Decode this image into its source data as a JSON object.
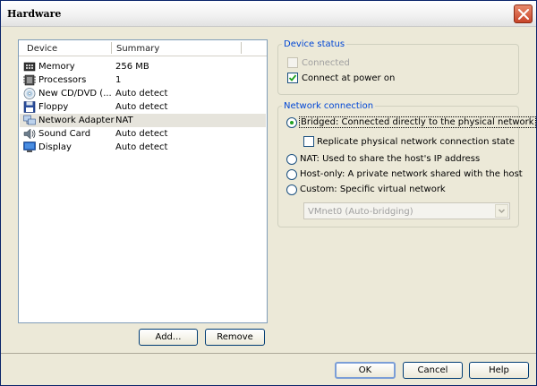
{
  "window": {
    "title": "Hardware"
  },
  "device_list": {
    "columns": [
      "Device",
      "Summary"
    ],
    "rows": [
      {
        "device": "Memory",
        "summary": "256 MB",
        "icon": "memory-icon"
      },
      {
        "device": "Processors",
        "summary": "1",
        "icon": "processor-icon"
      },
      {
        "device": "New CD/DVD (...",
        "summary": "Auto detect",
        "icon": "cd-dvd-icon"
      },
      {
        "device": "Floppy",
        "summary": "Auto detect",
        "icon": "floppy-icon"
      },
      {
        "device": "Network Adapter",
        "summary": "NAT",
        "icon": "network-adapter-icon",
        "selected": true
      },
      {
        "device": "Sound Card",
        "summary": "Auto detect",
        "icon": "sound-card-icon"
      },
      {
        "device": "Display",
        "summary": "Auto detect",
        "icon": "display-icon"
      }
    ]
  },
  "list_buttons": {
    "add": "Add...",
    "remove": "Remove"
  },
  "device_status": {
    "legend": "Device status",
    "connected": {
      "label": "Connected",
      "checked": false,
      "disabled": true
    },
    "connect_at_power_on": {
      "label": "Connect at power on",
      "checked": true
    }
  },
  "network_connection": {
    "legend": "Network connection",
    "bridged": "Bridged: Connected directly to the physical network",
    "replicate": "Replicate physical network connection state",
    "nat": "NAT: Used to share the host's IP address",
    "host_only": "Host-only: A private network shared with the host",
    "custom": "Custom: Specific virtual network",
    "selected": "bridged",
    "vmnet_select": "VMnet0 (Auto-bridging)"
  },
  "dialog_buttons": {
    "ok": "OK",
    "cancel": "Cancel",
    "help": "Help"
  },
  "colors": {
    "accent_legend": "#0046d5",
    "selected_row": "#e6e4dc",
    "radio_dot": "#21a121",
    "check_mark": "#21a121"
  }
}
